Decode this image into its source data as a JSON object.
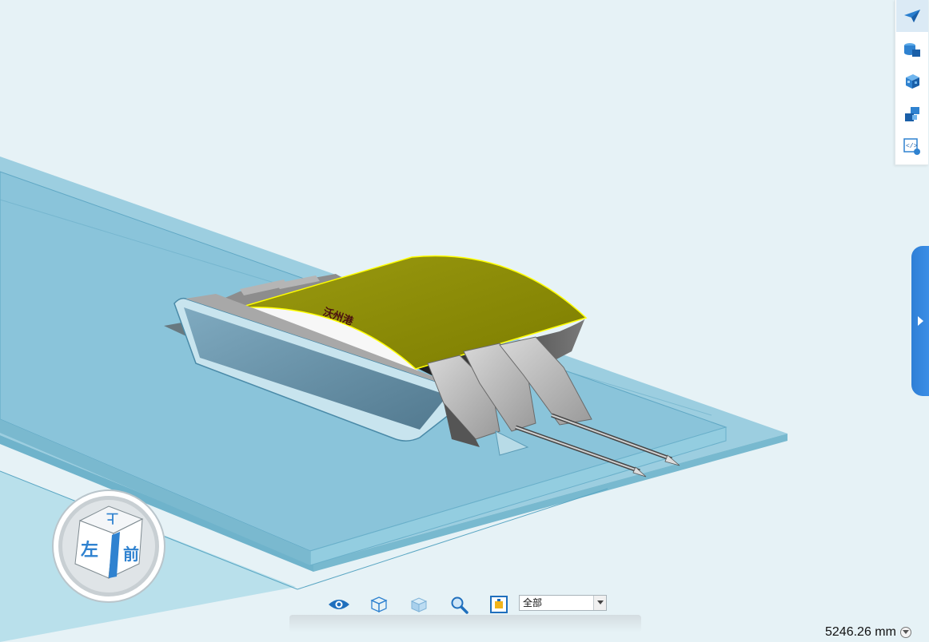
{
  "viewport": {
    "model_label": "沃州港",
    "background_color": "#e6f2f6",
    "ground_color": "#8fcadf",
    "highlight_color": "#808000",
    "selection_outline_color": "#ffff00"
  },
  "right_toolbar": {
    "items": [
      {
        "icon": "paper-plane-icon",
        "active": true
      },
      {
        "icon": "cylinder-box-icon",
        "active": false
      },
      {
        "icon": "checkered-cube-icon",
        "active": false
      },
      {
        "icon": "layered-cubes-icon",
        "active": false
      },
      {
        "icon": "code-window-icon",
        "active": false
      }
    ]
  },
  "collapse_tab": {
    "icon": "chevron-right-icon"
  },
  "view_cube": {
    "faces": {
      "top": "上",
      "left": "左",
      "front": "前"
    }
  },
  "bottom_toolbar": {
    "icons": [
      "eye-icon",
      "wireframe-cube-icon",
      "shaded-cube-icon",
      "zoom-icon",
      "fit-view-icon"
    ],
    "display_select": {
      "value": "全部"
    }
  },
  "scale": {
    "value": "5246.26 mm"
  },
  "colors": {
    "accent": "#1f78c8",
    "toolbar_bg": "#ffffff"
  }
}
